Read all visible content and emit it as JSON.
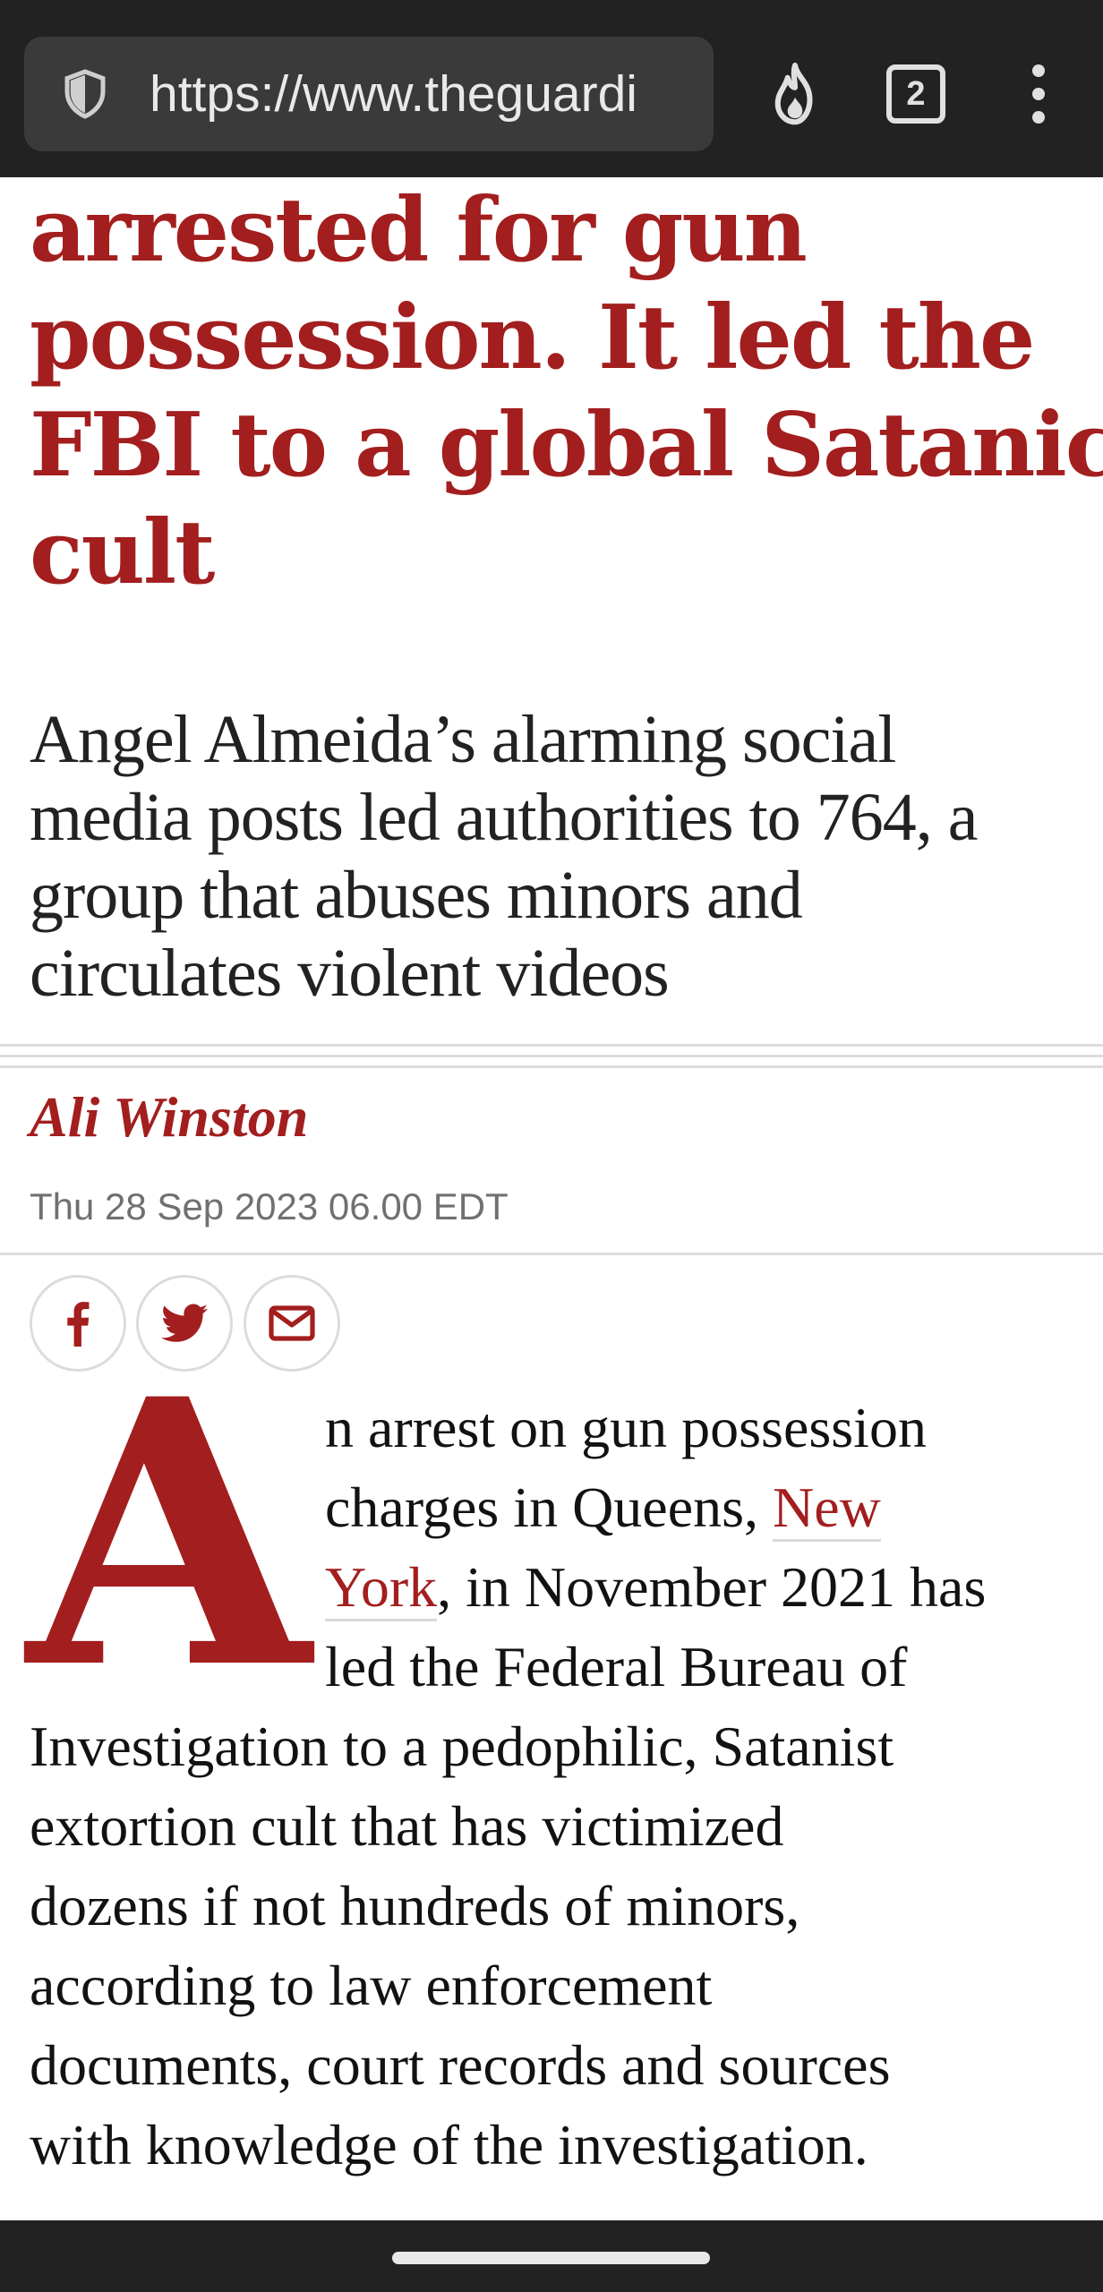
{
  "browser": {
    "url": "https://www.theguardi",
    "tab_count": "2",
    "icons": [
      "shield-icon",
      "fire-icon",
      "more-vert-icon"
    ]
  },
  "article": {
    "headline": "...arrested for gun possession. It led the FBI to a global Satanic cult",
    "headline_lines": [
      "arrested for gun",
      "possession. It led the",
      "FBI to a global Satanic",
      "cult"
    ],
    "standfirst": "Angel Almeida's alarming social media posts led authorities to 764, a group that abuses minors and circulates violent videos",
    "standfirst_lines": [
      "Angel Almeida’s alarming social",
      "media posts led authorities to 764, a",
      "group that abuses minors and",
      "circulates violent videos"
    ],
    "author": "Ali Winston",
    "dateline": "Thu 28 Sep 2023 06.00 EDT",
    "share": {
      "facebook_icon": "facebook-icon",
      "twitter_icon": "twitter-icon",
      "email_icon": "email-icon"
    },
    "dropcap": "A",
    "body": {
      "l1": "n arrest on gun possession",
      "l2_pre": "charges in Queens, ",
      "link_part1": "New",
      "link_part2": "York",
      "l3_post": ", in November 2021 has",
      "l4": "led the Federal Bureau of",
      "l5": "Investigation to a pedophilic, Satanist",
      "l6": "extortion cult that has victimized",
      "l7": "dozens if not hundreds of minors,",
      "l8": "according to law enforcement",
      "l9": "documents, court records and sources",
      "l10": "with knowledge of the investigation."
    }
  },
  "colors": {
    "accent": "#a31e1e",
    "topbar": "#222222",
    "text": "#121212"
  }
}
